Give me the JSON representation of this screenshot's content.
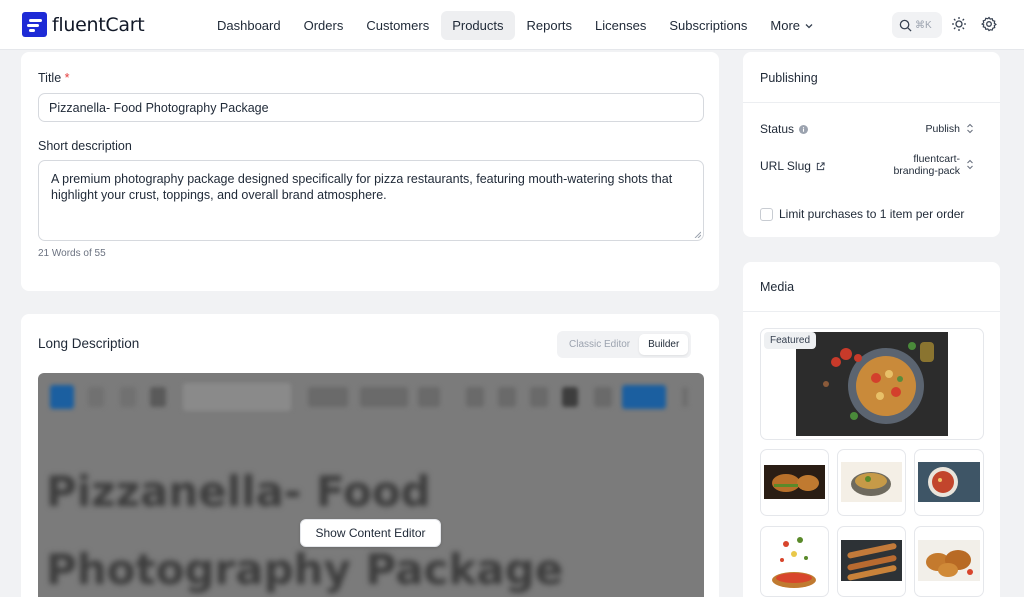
{
  "brand": {
    "name": "fluentCart",
    "accent": "#1e2bd6"
  },
  "nav": {
    "items": [
      "Dashboard",
      "Orders",
      "Customers",
      "Products",
      "Reports",
      "Licenses",
      "Subscriptions",
      "More"
    ],
    "active": "Products",
    "search_shortcut": "⌘K"
  },
  "product_form": {
    "title_label": "Title",
    "required_mark": "*",
    "title_value": "Pizzanella- Food Photography Package",
    "short_desc_label": "Short description",
    "short_desc_value": "A premium photography package designed specifically for pizza restaurants, featuring mouth-watering shots that highlight your crust, toppings, and overall brand atmosphere.",
    "word_count": "21 Words of 55"
  },
  "long_description": {
    "title": "Long Description",
    "modes": [
      "Classic Editor",
      "Builder"
    ],
    "active_mode": "Builder",
    "preview_line1": "Pizzanella- Food",
    "preview_line2": "Photography Package",
    "show_editor_label": "Show Content Editor"
  },
  "publishing": {
    "title": "Publishing",
    "status_label": "Status",
    "status_value": "Publish",
    "slug_label": "URL Slug",
    "slug_value_1": "fluentcart-",
    "slug_value_2": "branding-pack",
    "limit_label": "Limit purchases to 1 item per order",
    "limit_checked": false
  },
  "media": {
    "title": "Media",
    "featured_badge": "Featured",
    "thumbnails": [
      "burger",
      "noodle-bowl",
      "soup-bowl",
      "pizza",
      "skewers",
      "fried-chicken"
    ]
  }
}
